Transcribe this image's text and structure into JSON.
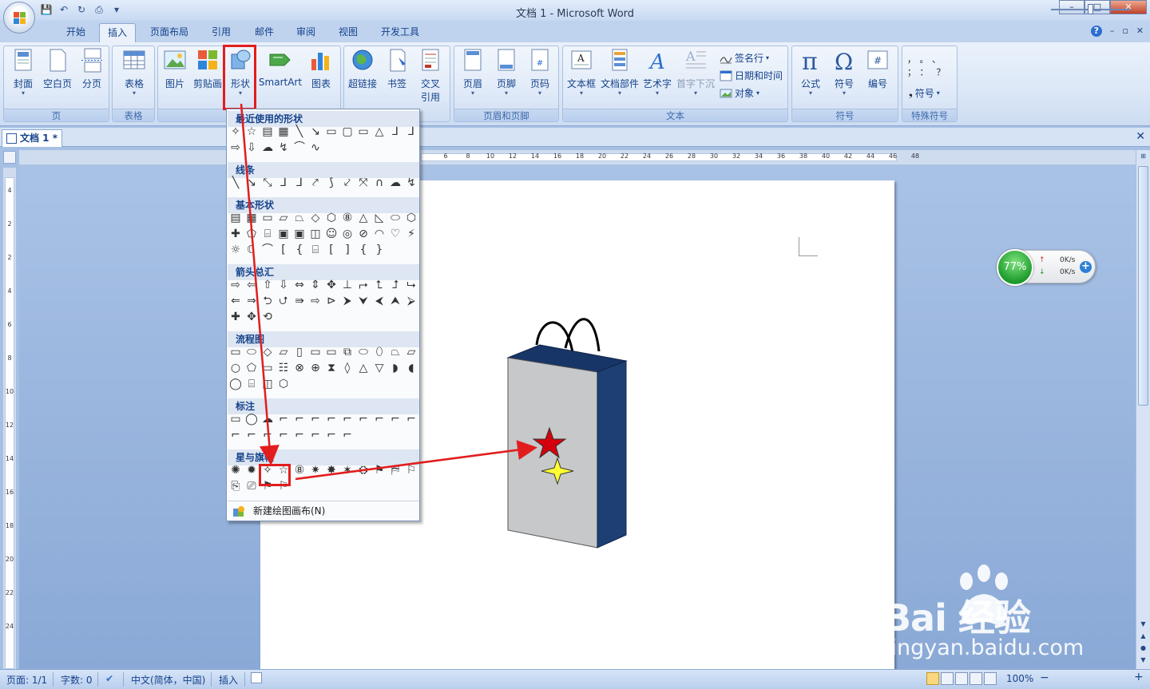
{
  "window": {
    "title": "文档 1 - Microsoft Word",
    "minimize": "–",
    "restore": "□",
    "close": "✕"
  },
  "qat": {
    "save_icon": "💾",
    "undo_icon": "↶",
    "redo_icon": "↻",
    "print_icon": "⎙",
    "more_icon": "▾"
  },
  "tabs": [
    {
      "label": "开始",
      "active": false
    },
    {
      "label": "插入",
      "active": true
    },
    {
      "label": "页面布局",
      "active": false
    },
    {
      "label": "引用",
      "active": false
    },
    {
      "label": "邮件",
      "active": false
    },
    {
      "label": "审阅",
      "active": false
    },
    {
      "label": "视图",
      "active": false
    },
    {
      "label": "开发工具",
      "active": false
    }
  ],
  "help_ctrls": {
    "help": "?",
    "min": "–",
    "restore": "▫",
    "close": "✕"
  },
  "ribbon": {
    "groups": [
      {
        "label": "页"
      },
      {
        "label": "表格"
      },
      {
        "label": "插图"
      },
      {
        "label": "链接"
      },
      {
        "label": "页眉和页脚"
      },
      {
        "label": "文本"
      },
      {
        "label": "符号"
      },
      {
        "label": "特殊符号"
      }
    ],
    "buttons": {
      "cover": "封面",
      "blank": "空白页",
      "pagebreak": "分页",
      "table": "表格",
      "picture": "图片",
      "clipart": "剪贴画",
      "shapes": "形状",
      "smartart": "SmartArt",
      "chart": "图表",
      "hyperlink": "超链接",
      "bookmark": "书签",
      "crossref_1": "交叉",
      "crossref_2": "引用",
      "header": "页眉",
      "footer": "页脚",
      "pagenum": "页码",
      "textbox": "文本框",
      "quickparts": "文档部件",
      "wordart": "艺术字",
      "dropcap": "首字下沉",
      "signature": "签名行",
      "datetime": "日期和时间",
      "object": "对象",
      "equation": "公式",
      "symbol": "符号",
      "number": "编号",
      "special_symbol": "符号"
    },
    "dropdown_arrow": "▾"
  },
  "document_tab": {
    "label": "文档 1 *",
    "close": "✕"
  },
  "hruler_numbers": [
    "6",
    "8",
    "10",
    "12",
    "14",
    "16",
    "18",
    "20",
    "22",
    "24",
    "26",
    "28",
    "30",
    "32",
    "34",
    "36",
    "38",
    "40",
    "42",
    "44",
    "46",
    "48"
  ],
  "vruler_numbers": [
    "4",
    "2",
    "2",
    "4",
    "6",
    "8",
    "10",
    "12",
    "14",
    "16",
    "18",
    "20",
    "22",
    "24"
  ],
  "shapes_menu": {
    "sections": [
      {
        "title": "最近使用的形状"
      },
      {
        "title": "线条"
      },
      {
        "title": "基本形状"
      },
      {
        "title": "箭头总汇"
      },
      {
        "title": "流程图"
      },
      {
        "title": "标注"
      },
      {
        "title": "星与旗帜"
      }
    ],
    "recent_row1": [
      "✧",
      "☆",
      "▤",
      "▦",
      "╲",
      "↘",
      "▭",
      "▢",
      "▭",
      "△",
      "⅃",
      "⅃"
    ],
    "recent_row2": [
      "⇨",
      "⇩",
      "☁",
      "↯",
      "⌒",
      "∿"
    ],
    "lines_row": [
      "╲",
      "↘",
      "⤡",
      "⅃",
      "⅃",
      "⤤",
      "⟆",
      "⤦",
      "⤧",
      "∩",
      "☁",
      "↯"
    ],
    "basic_row1": [
      "▤",
      "▦",
      "▭",
      "▱",
      "⏢",
      "◇",
      "⬡",
      "⑧",
      "△",
      "◺",
      "⬭",
      "⬡"
    ],
    "basic_row2": [
      "✚",
      "⬠",
      "⌸",
      "▣",
      "▣",
      "◫",
      "☺",
      "◎",
      "⊘",
      "◠",
      "♡",
      "⚡"
    ],
    "basic_row3": [
      "☼",
      "☾",
      "⌒",
      "[",
      "{",
      "⌸",
      "[",
      "]",
      "{",
      "}"
    ],
    "arrow_row1": [
      "⇨",
      "⇦",
      "⇧",
      "⇩",
      "⇔",
      "⇕",
      "✥",
      "⊥",
      "⮣",
      "⮤",
      "⮥",
      "⮡"
    ],
    "arrow_row2": [
      "⇐",
      "⇒",
      "⮌",
      "⮍",
      "⇛",
      "⇨",
      "⊳",
      "⮞",
      "⮟",
      "⮜",
      "⮝",
      "⮚"
    ],
    "arrow_row3": [
      "✚",
      "✥",
      "⟲"
    ],
    "flow_row1": [
      "▭",
      "⬭",
      "◇",
      "▱",
      "▯",
      "▭",
      "▭",
      "⧉",
      "⬭",
      "⬯",
      "⏢",
      "⏥"
    ],
    "flow_row2": [
      "○",
      "⬠",
      "▭",
      "☷",
      "⊗",
      "⊕",
      "⧗",
      "◊",
      "△",
      "▽",
      "◗",
      "◖"
    ],
    "flow_row3": [
      "◯",
      "⌸",
      "◫",
      "⬡"
    ],
    "callout_row1": [
      "▭",
      "◯",
      "☁",
      "⌐",
      "⌐",
      "⌐",
      "⌐",
      "⌐",
      "⌐",
      "⌐",
      "⌐",
      "⌐"
    ],
    "callout_row2": [
      "⌐",
      "⌐",
      "⌐",
      "⌐",
      "⌐",
      "⌐",
      "⌐",
      "⌐"
    ],
    "stars_row1": [
      "✺",
      "✹",
      "✧",
      "☆",
      "⑧",
      "✷",
      "✸",
      "✶",
      "⛭",
      "⚑",
      "⛿",
      "⚐"
    ],
    "stars_row2": [
      "⎘",
      "⎚",
      "⚑",
      "⚐"
    ],
    "new_canvas": "新建绘图画布(N)"
  },
  "status": {
    "page": "页面: 1/1",
    "words": "字数: 0",
    "language": "中文(简体，中国)",
    "mode": "插入",
    "zoom": "100%",
    "zoom_minus": "−",
    "zoom_plus": "+",
    "zoom_level": 0.5
  },
  "net_widget": {
    "percent": "77%",
    "up": "0K/s",
    "down": "0K/s",
    "up_arrow": "↑",
    "down_arrow": "↓",
    "plus": "+"
  },
  "watermark": {
    "brand": "Bai 经验",
    "url": "jingyan.baidu.com"
  },
  "colors": {
    "highlight_red": "#e21d1d",
    "bag_front": "#c6c8ca",
    "bag_side": "#1e3f73",
    "star_red": "#d4000b",
    "star_yellow": "#ffff33"
  }
}
